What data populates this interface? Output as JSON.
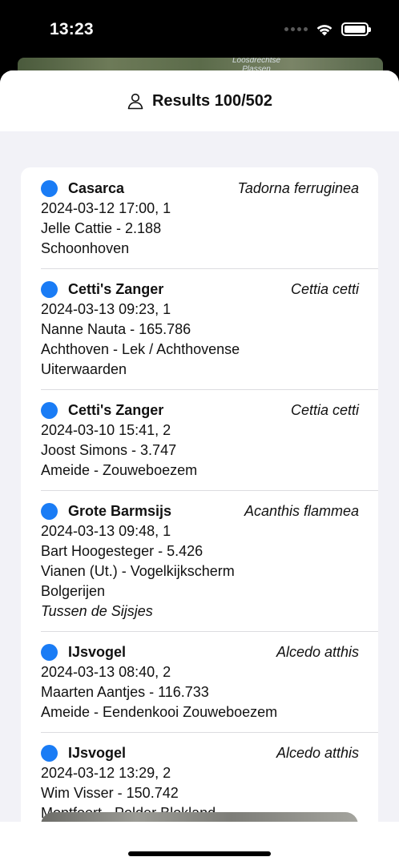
{
  "status_bar": {
    "time": "13:23"
  },
  "map": {
    "label": "Loosdrechtse\nPlassen"
  },
  "header": {
    "title": "Results 100/502",
    "icon": "person-icon"
  },
  "colors": {
    "accent": "#1a7cf5",
    "sheet_background": "#f2f2f7"
  },
  "results": [
    {
      "name": "Casarca",
      "latin": "Tadorna ferruginea",
      "datetime": "2024-03-12 17:00, 1",
      "observer": "Jelle Cattie - 2.188",
      "location": "Schoonhoven",
      "note": ""
    },
    {
      "name": "Cetti's Zanger",
      "latin": "Cettia cetti",
      "datetime": "2024-03-13 09:23, 1",
      "observer": "Nanne Nauta - 165.786",
      "location": "Achthoven - Lek / Achthovense Uiterwaarden",
      "note": ""
    },
    {
      "name": "Cetti's Zanger",
      "latin": "Cettia cetti",
      "datetime": "2024-03-10 15:41, 2",
      "observer": "Joost Simons - 3.747",
      "location": "Ameide - Zouweboezem",
      "note": ""
    },
    {
      "name": "Grote Barmsijs",
      "latin": "Acanthis flammea",
      "datetime": "2024-03-13 09:48, 1",
      "observer": "Bart Hoogesteger - 5.426",
      "location": "Vianen (Ut.) - Vogelkijkscherm Bolgerijen",
      "note": "Tussen de Sijsjes"
    },
    {
      "name": "IJsvogel",
      "latin": "Alcedo atthis",
      "datetime": "2024-03-13 08:40, 2",
      "observer": "Maarten Aantjes - 116.733",
      "location": "Ameide - Eendenkooi Zouweboezem",
      "note": ""
    },
    {
      "name": "IJsvogel",
      "latin": "Alcedo atthis",
      "datetime": "2024-03-12 13:29, 2",
      "observer": "Wim Visser - 150.742",
      "location": "Montfoort - Polder Blokland",
      "note": ""
    }
  ]
}
